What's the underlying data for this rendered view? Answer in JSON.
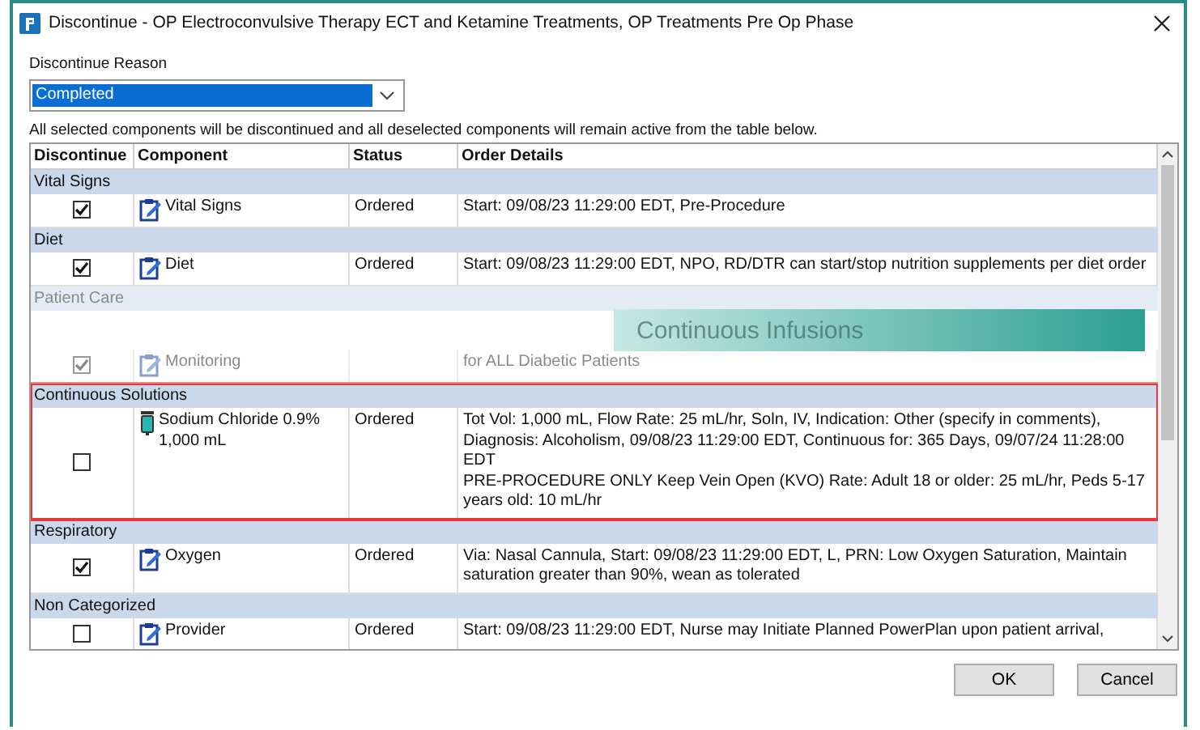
{
  "window": {
    "title": "Discontinue - OP Electroconvulsive Therapy ECT and Ketamine Treatments, OP Treatments Pre Op Phase"
  },
  "reason": {
    "label": "Discontinue Reason",
    "value": "Completed"
  },
  "info": "All selected components will be discontinued and all deselected components will remain active from the table below.",
  "table": {
    "columns": [
      "Discontinue",
      "Component",
      "Status",
      "Order Details"
    ],
    "groups": [
      {
        "name": "Vital Signs",
        "faded": false,
        "highlighted": false,
        "items": [
          {
            "checked": true,
            "kind": "order",
            "component": "Vital Signs",
            "status": "Ordered",
            "details": [
              "Start: 09/08/23 11:29:00 EDT, Pre-Procedure"
            ]
          }
        ]
      },
      {
        "name": "Diet",
        "faded": false,
        "highlighted": false,
        "items": [
          {
            "checked": true,
            "kind": "order",
            "component": "Diet",
            "status": "Ordered",
            "details": [
              "Start: 09/08/23 11:29:00 EDT, NPO, RD/DTR can start/stop nutrition supplements per diet order"
            ]
          }
        ]
      },
      {
        "name": "Patient Care",
        "faded": true,
        "highlighted": false,
        "items": [
          {
            "checked": true,
            "kind": "order",
            "component": "Monitoring",
            "details": [
              "for ALL Diabetic Patients"
            ]
          }
        ]
      },
      {
        "name": "Continuous Solutions",
        "faded": false,
        "highlighted": true,
        "items": [
          {
            "checked": false,
            "kind": "iv",
            "component": "Sodium Chloride 0.9% 1,000 mL",
            "status": "Ordered",
            "details": [
              "Tot Vol: 1,000 mL, Flow Rate: 25 mL/hr, Soln, IV, Indication: Other (specify in comments), Diagnosis: Alcoholism, 09/08/23 11:29:00 EDT, Continuous for: 365 Days, 09/07/24 11:28:00 EDT",
              "PRE-PROCEDURE ONLY Keep Vein Open (KVO) Rate: Adult 18 or older: 25 mL/hr, Peds 5-17 years old: 10 mL/hr"
            ]
          }
        ]
      },
      {
        "name": "Respiratory",
        "faded": false,
        "highlighted": false,
        "items": [
          {
            "checked": true,
            "kind": "order",
            "component": "Oxygen",
            "status": "Ordered",
            "details": [
              "Via: Nasal Cannula, Start: 09/08/23 11:29:00 EDT, L, PRN: Low Oxygen Saturation, Maintain saturation greater than 90%, wean as tolerated"
            ]
          }
        ]
      },
      {
        "name": "Non Categorized",
        "faded": false,
        "highlighted": false,
        "items": [
          {
            "checked": false,
            "kind": "order",
            "component": "Provider",
            "status": "Ordered",
            "details": [
              "Start: 09/08/23 11:29:00 EDT, Nurse may Initiate Planned PowerPlan upon patient arrival,"
            ]
          }
        ]
      }
    ]
  },
  "overlay": {
    "title": "Continuous Infusions"
  },
  "buttons": [
    "OK",
    "Cancel"
  ]
}
